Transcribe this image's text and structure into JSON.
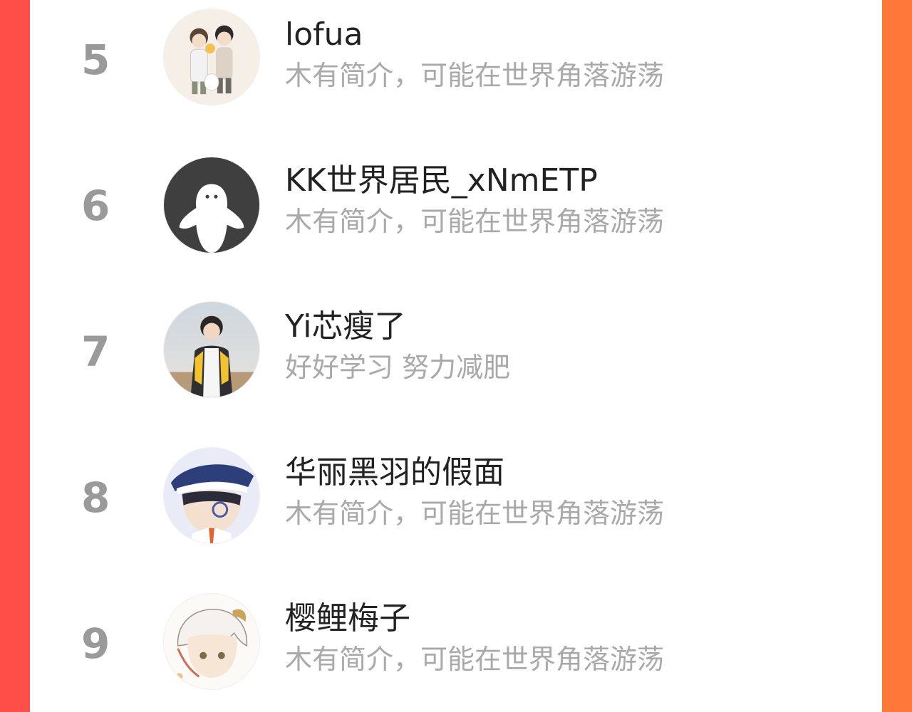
{
  "accent_colors": {
    "left": "#ff4e48",
    "right": "#ff7a3a"
  },
  "list": [
    {
      "rank": "5",
      "name": "lofua",
      "bio": "木有简介，可能在世界角落游荡",
      "avatar": "couple-illustration-avatar"
    },
    {
      "rank": "6",
      "name": "KK世界居民_xNmETP",
      "bio": "木有简介，可能在世界角落游荡",
      "avatar": "default-ghost-avatar"
    },
    {
      "rank": "7",
      "name": "Yi芯瘦了",
      "bio": "好好学习 努力减肥",
      "avatar": "photo-avatar"
    },
    {
      "rank": "8",
      "name": "华丽黑羽的假面",
      "bio": "木有简介，可能在世界角落游荡",
      "avatar": "anime-hat-avatar"
    },
    {
      "rank": "9",
      "name": "樱鲤梅子",
      "bio": "木有简介，可能在世界角落游荡",
      "avatar": "anime-white-hair-avatar"
    }
  ]
}
